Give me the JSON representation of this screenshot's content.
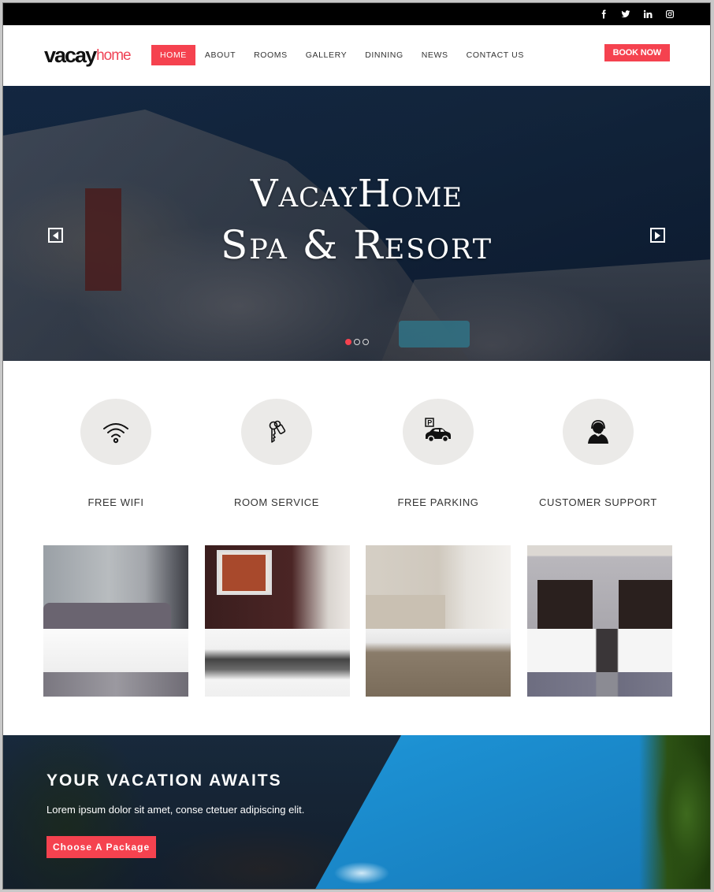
{
  "topbar": {
    "social": [
      {
        "icon": "facebook-icon",
        "glyph": "f"
      },
      {
        "icon": "twitter-icon",
        "glyph": "t"
      },
      {
        "icon": "linkedin-icon",
        "glyph": "in"
      },
      {
        "icon": "instagram-icon",
        "glyph": "ig"
      }
    ]
  },
  "header": {
    "logo_main": "vacay",
    "logo_accent": "home",
    "nav": [
      {
        "label": "HOME",
        "active": true
      },
      {
        "label": "ABOUT"
      },
      {
        "label": "ROOMS"
      },
      {
        "label": "GALLERY"
      },
      {
        "label": "DINNING"
      },
      {
        "label": "NEWS"
      },
      {
        "label": "CONTACT US"
      }
    ],
    "cta_label": "BOOK NOW"
  },
  "hero": {
    "title_line1": "VacayHome",
    "title_line2": "Spa & Resort",
    "slides": 3,
    "active_slide": 1
  },
  "features": [
    {
      "icon": "wifi-icon",
      "label": "FREE WIFI"
    },
    {
      "icon": "keys-icon",
      "label": "ROOM SERVICE"
    },
    {
      "icon": "parking-car-icon",
      "label": "FREE PARKING"
    },
    {
      "icon": "headset-support-icon",
      "label": "CUSTOMER SUPPORT"
    }
  ],
  "rooms": [
    {
      "name": "room-photo-1"
    },
    {
      "name": "room-photo-2"
    },
    {
      "name": "room-photo-3"
    },
    {
      "name": "room-photo-4"
    }
  ],
  "promo": {
    "title": "YOUR VACATION AWAITS",
    "text": "Lorem ipsum dolor sit amet, conse ctetuer adipiscing elit.",
    "button_label": "Choose A Package"
  },
  "colors": {
    "accent": "#f5424f",
    "topbar": "#000000",
    "feature_circle": "#ebeae8"
  }
}
